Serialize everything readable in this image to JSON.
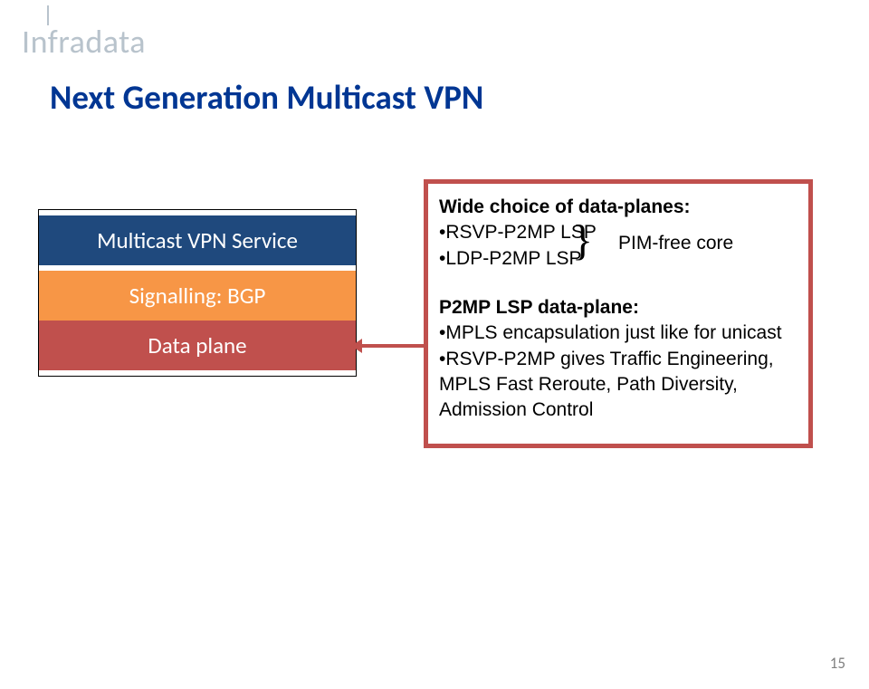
{
  "logo_text": "Infradata",
  "title": "Next Generation Multicast VPN",
  "stack": {
    "service": "Multicast VPN Service",
    "signalling": "Signalling: BGP",
    "dataplane": "Data plane"
  },
  "info": {
    "heading1": "Wide choice of data-planes:",
    "bullet_rsvp": "•RSVP-P2MP LSP",
    "bullet_ldp": "•LDP-P2MP LSP",
    "pim": "PIM-free core",
    "heading2": "P2MP LSP data-plane:",
    "bullet_mpls": "•MPLS encapsulation just like for unicast",
    "bullet_te": "•RSVP-P2MP gives Traffic Engineering, MPLS Fast Reroute, Path Diversity, Admission Control"
  },
  "pagenum": "15"
}
